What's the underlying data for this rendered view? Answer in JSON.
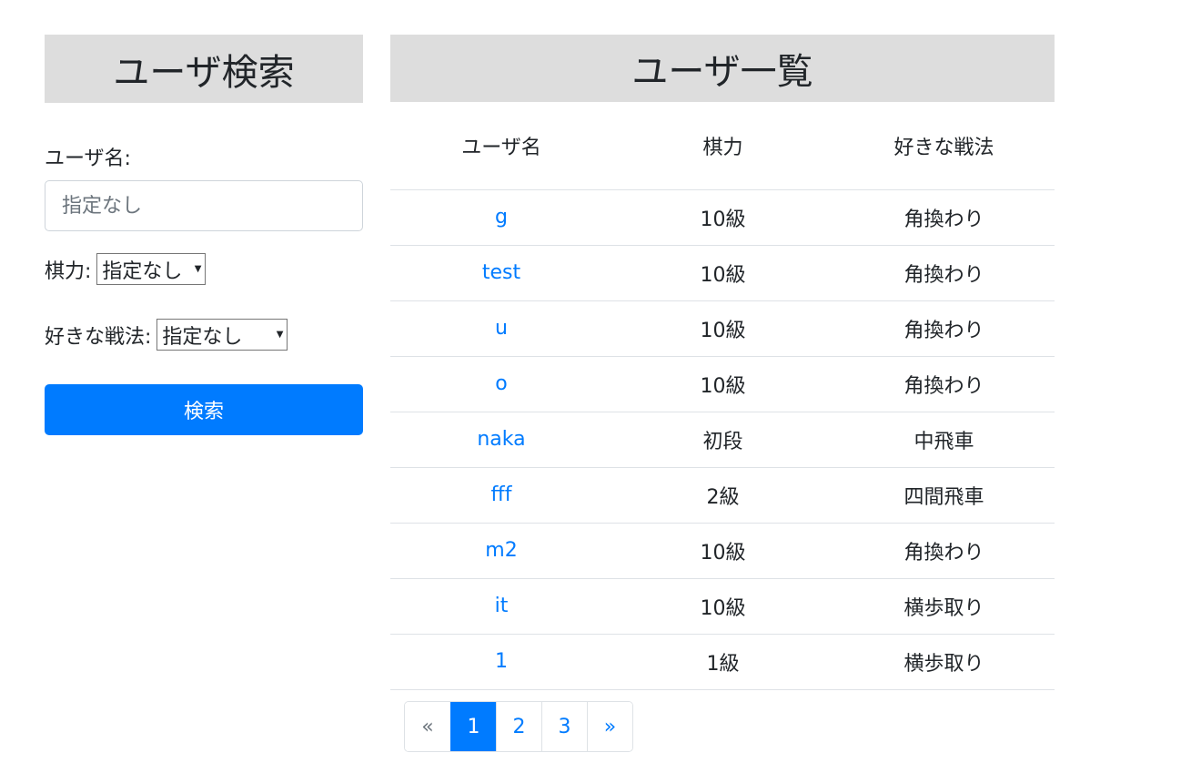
{
  "search_panel": {
    "title": "ユーザ検索",
    "name_label": "ユーザ名:",
    "name_placeholder": "指定なし",
    "name_value": "",
    "rank_label": "棋力:",
    "rank_selected": "指定なし",
    "tactic_label": "好きな戦法:",
    "tactic_selected": "指定なし",
    "search_button": "検索"
  },
  "list_panel": {
    "title": "ユーザ一覧",
    "columns": [
      "ユーザ名",
      "棋力",
      "好きな戦法"
    ],
    "rows": [
      {
        "name": "g",
        "rank": "10級",
        "tactic": "角換わり"
      },
      {
        "name": "test",
        "rank": "10級",
        "tactic": "角換わり"
      },
      {
        "name": "u",
        "rank": "10級",
        "tactic": "角換わり"
      },
      {
        "name": "o",
        "rank": "10級",
        "tactic": "角換わり"
      },
      {
        "name": "naka",
        "rank": "初段",
        "tactic": "中飛車"
      },
      {
        "name": "fff",
        "rank": "2級",
        "tactic": "四間飛車"
      },
      {
        "name": "m2",
        "rank": "10級",
        "tactic": "角換わり"
      },
      {
        "name": "it",
        "rank": "10級",
        "tactic": "横歩取り"
      },
      {
        "name": "1",
        "rank": "1級",
        "tactic": "横歩取り"
      }
    ]
  },
  "pagination": {
    "prev": "«",
    "pages": [
      "1",
      "2",
      "3"
    ],
    "active_page": "1",
    "next": "»"
  },
  "colors": {
    "accent": "#007bff",
    "header_bg": "#dddddd"
  }
}
